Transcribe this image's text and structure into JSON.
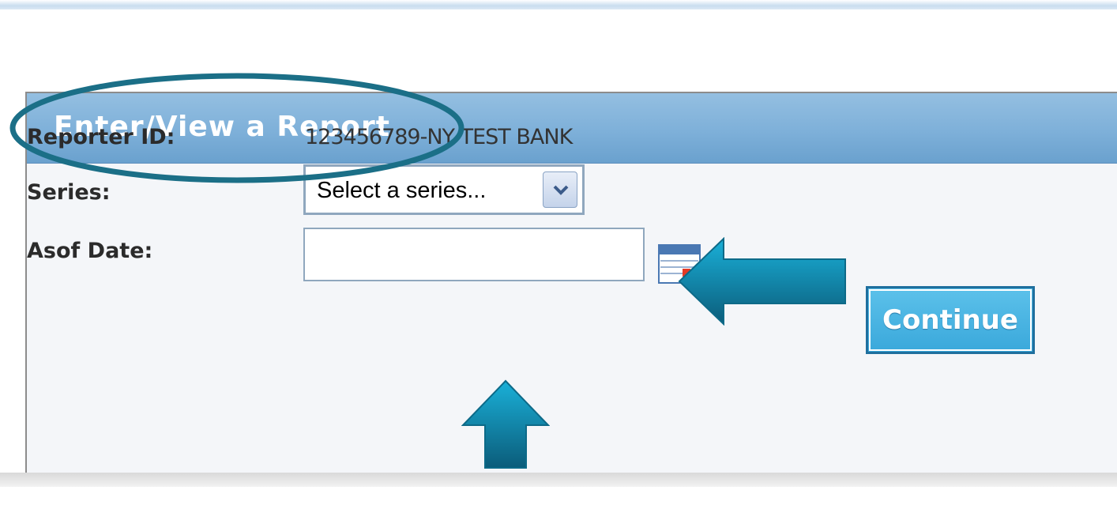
{
  "panel": {
    "title": "Enter/View a Report"
  },
  "form": {
    "reporter_id_label": "Reporter ID:",
    "reporter_id_value": "123456789-NY TEST BANK",
    "series_label": "Series:",
    "series_selected": "Select a series...",
    "asof_date_label": "Asof Date:",
    "asof_date_value": ""
  },
  "buttons": {
    "continue_label": "Continue"
  },
  "icons": {
    "dropdown": "chevron-down-icon",
    "calendar": "calendar-icon"
  },
  "colors": {
    "header_blue": "#7eb0d9",
    "annotation_teal": "#1b6f87",
    "button_blue": "#3aa8db"
  }
}
